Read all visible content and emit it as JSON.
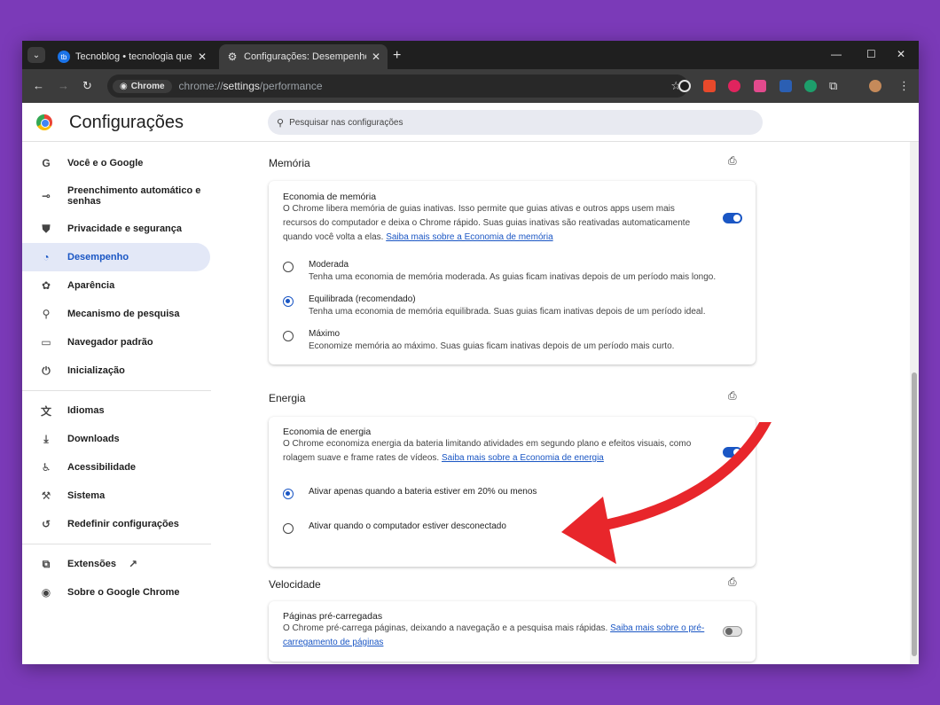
{
  "tabs": [
    {
      "label": "Tecnoblog • tecnologia que inte",
      "favicon_color": "#1a73e8",
      "active": false
    },
    {
      "label": "Configurações: Desempenho",
      "active": true
    }
  ],
  "toolbar": {
    "chip_label": "Chrome",
    "url_prefix": "chrome://",
    "url_host": "settings",
    "url_path": "/performance"
  },
  "header": {
    "title": "Configurações",
    "search_placeholder": "Pesquisar nas configurações"
  },
  "sidebar": {
    "items": [
      {
        "icon": "G",
        "label": "Você e o Google"
      },
      {
        "icon": "⊸",
        "label": "Preenchimento automático e senhas"
      },
      {
        "icon": "⛊",
        "label": "Privacidade e segurança"
      },
      {
        "icon": "◔",
        "label": "Desempenho",
        "active": true
      },
      {
        "icon": "✿",
        "label": "Aparência"
      },
      {
        "icon": "⚲",
        "label": "Mecanismo de pesquisa"
      },
      {
        "icon": "▭",
        "label": "Navegador padrão"
      },
      {
        "icon": "⏻",
        "label": "Inicialização"
      },
      {
        "icon": "文",
        "label": "Idiomas"
      },
      {
        "icon": "⤓",
        "label": "Downloads"
      },
      {
        "icon": "♿",
        "label": "Acessibilidade"
      },
      {
        "icon": "⚒",
        "label": "Sistema"
      },
      {
        "icon": "↺",
        "label": "Redefinir configurações"
      },
      {
        "icon": "⧉",
        "label": "Extensões"
      },
      {
        "icon": "◉",
        "label": "Sobre o Google Chrome"
      }
    ]
  },
  "memory": {
    "section": "Memória",
    "title": "Economia de memória",
    "desc": "O Chrome libera memória de guias inativas. Isso permite que guias ativas e outros apps usem mais recursos do computador e deixa o Chrome rápido. Suas guias inativas são reativadas automaticamente quando você volta a elas. ",
    "link": "Saiba mais sobre a Economia de memória",
    "toggle_on": true,
    "options": [
      {
        "label": "Moderada",
        "sub": "Tenha uma economia de memória moderada. As guias ficam inativas depois de um período mais longo.",
        "checked": false
      },
      {
        "label": "Equilibrada (recomendado)",
        "sub": "Tenha uma economia de memória equilibrada. Suas guias ficam inativas depois de um período ideal.",
        "checked": true
      },
      {
        "label": "Máximo",
        "sub": "Economize memória ao máximo. Suas guias ficam inativas depois de um período mais curto.",
        "checked": false
      }
    ]
  },
  "energy": {
    "section": "Energia",
    "title": "Economia de energia",
    "desc": "O Chrome economiza energia da bateria limitando atividades em segundo plano e efeitos visuais, como rolagem suave e frame rates de vídeos. ",
    "link": "Saiba mais sobre a Economia de energia",
    "options": [
      {
        "label": "Ativar apenas quando a bateria estiver em 20% ou menos",
        "checked": true
      },
      {
        "label": "Ativar quando o computador estiver desconectado",
        "checked": false
      }
    ]
  },
  "speed": {
    "section": "Velocidade",
    "title": "Páginas pré-carregadas",
    "desc": "O Chrome pré-carrega páginas, deixando a navegação e a pesquisa mais rápidas. ",
    "link": "Saiba mais sobre o pré-carregamento de páginas",
    "toggle_on": false
  },
  "colors": {
    "accent": "#1a56c4",
    "arrow": "#e8262b",
    "background": "#7b3ab8"
  }
}
